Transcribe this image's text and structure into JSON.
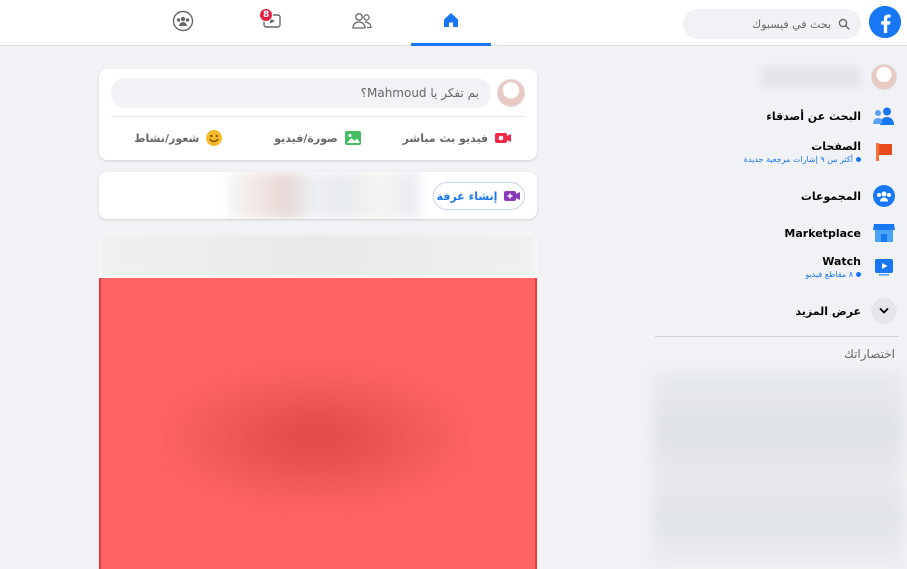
{
  "header": {
    "search_placeholder": "بحث في فيسبوك",
    "tabs": [
      {
        "name": "home",
        "icon": "home-icon",
        "active": true
      },
      {
        "name": "friends",
        "icon": "friends-icon",
        "active": false
      },
      {
        "name": "watch",
        "icon": "watch-icon",
        "active": false,
        "badge": "8"
      },
      {
        "name": "groups",
        "icon": "groups-icon",
        "active": false
      }
    ]
  },
  "sidebar": {
    "items": [
      {
        "label": "البحث عن أصدقاء",
        "icon": "find-friends-icon"
      },
      {
        "label": "الصفحات",
        "sub": "أكثر من ٩ إشارات مرجعية جديدة",
        "icon": "pages-flag-icon"
      },
      {
        "label": "المجموعات",
        "icon": "groups-icon"
      },
      {
        "label": "Marketplace",
        "icon": "marketplace-icon"
      },
      {
        "label": "Watch",
        "sub": "٨ مقاطع فيديو",
        "icon": "watch-icon"
      },
      {
        "label": "عرض المزيد",
        "icon": "chevron-down-icon"
      }
    ],
    "shortcuts_title": "اختصاراتك"
  },
  "composer": {
    "placeholder": "بم تفكر يا Mahmoud؟",
    "actions": [
      {
        "label": "فيديو بث مباشر",
        "icon": "live-video-icon",
        "color": "#f02849"
      },
      {
        "label": "صورة/فيديو",
        "icon": "photo-icon",
        "color": "#45bd62"
      },
      {
        "label": "شعور/نشاط",
        "icon": "feeling-icon",
        "color": "#f7b928"
      }
    ]
  },
  "rooms": {
    "create_label": "إنشاء غرفة"
  },
  "colors": {
    "brand": "#1877f2",
    "badge": "#e41e3f"
  }
}
